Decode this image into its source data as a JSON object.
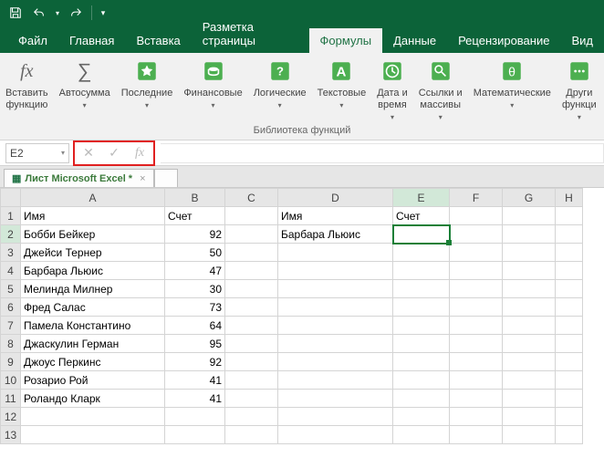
{
  "quickAccess": {
    "save": "save-icon",
    "undo": "undo-icon",
    "redo": "redo-icon"
  },
  "tabs": {
    "file": "Файл",
    "home": "Главная",
    "insert": "Вставка",
    "pageLayout": "Разметка страницы",
    "formulas": "Формулы",
    "data": "Данные",
    "review": "Рецензирование",
    "view": "Вид"
  },
  "activeTab": "formulas",
  "ribbon": {
    "insertFunction": "Вставить\nфункцию",
    "autosum": "Автосумма",
    "recent": "Последние",
    "financial": "Финансовые",
    "logical": "Логические",
    "text": "Текстовые",
    "dateTime": "Дата и\nвремя",
    "lookup": "Ссылки и\nмассивы",
    "math": "Математические",
    "more": "Други\nфункци",
    "groupLabel": "Библиотека функций"
  },
  "nameBox": "E2",
  "formulaBar": "",
  "sheetTab": "Лист Microsoft Excel *",
  "columns": [
    "A",
    "B",
    "C",
    "D",
    "E",
    "F",
    "G",
    "H"
  ],
  "rows": [
    {
      "n": 1,
      "A": "Имя",
      "B": "Счет",
      "D": "Имя",
      "E": "Счет"
    },
    {
      "n": 2,
      "A": "Бобби Бейкер",
      "B": "92",
      "D": "Барбара Льюис",
      "E": ""
    },
    {
      "n": 3,
      "A": "Джейси Тернер",
      "B": "50"
    },
    {
      "n": 4,
      "A": "Барбара Льюис",
      "B": "47"
    },
    {
      "n": 5,
      "A": "Мелинда Милнер",
      "B": "30"
    },
    {
      "n": 6,
      "A": "Фред Салас",
      "B": "73"
    },
    {
      "n": 7,
      "A": "Памела Константино",
      "B": "64"
    },
    {
      "n": 8,
      "A": "Джаскулин Герман",
      "B": "95"
    },
    {
      "n": 9,
      "A": "Джоус Перкинс",
      "B": "92"
    },
    {
      "n": 10,
      "A": "Розарио Рой",
      "B": "41"
    },
    {
      "n": 11,
      "A": "Роландо Кларк",
      "B": "41"
    },
    {
      "n": 12
    },
    {
      "n": 13
    }
  ],
  "selectedCell": {
    "row": 2,
    "col": "E"
  }
}
